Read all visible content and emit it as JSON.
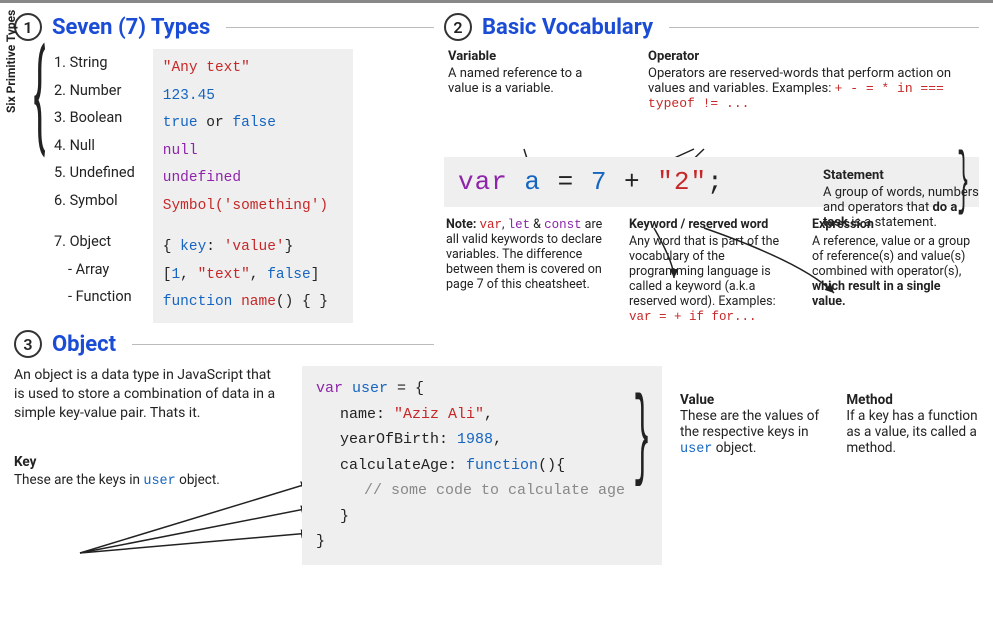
{
  "section1": {
    "num": "1",
    "title": "Seven (7) Types",
    "vertical_label": "Six Primitive Types",
    "labels": [
      "1. String",
      "2. Number",
      "3. Boolean",
      "4. Null",
      "5. Undefined",
      "6. Symbol"
    ],
    "label7": "7. Object",
    "label7a": "- Array",
    "label7b": "- Function",
    "ex_string": "\"Any text\"",
    "ex_number": "123.45",
    "ex_bool_true": "true",
    "ex_bool_or": " or ",
    "ex_bool_false": "false",
    "ex_null": "null",
    "ex_undef": "undefined",
    "ex_symbol_fn": "Symbol",
    "ex_symbol_arg": "('something')",
    "ex_obj_open": "{ ",
    "ex_obj_key": "key",
    "ex_obj_colon": ": ",
    "ex_obj_val": "'value'",
    "ex_obj_close": "}",
    "ex_arr_open": "[",
    "ex_arr_1": "1",
    "ex_arr_c1": ", ",
    "ex_arr_2": "\"text\"",
    "ex_arr_c2": ", ",
    "ex_arr_3": "false",
    "ex_arr_close": "]",
    "ex_fn_kw": "function ",
    "ex_fn_name": "name",
    "ex_fn_paren": "() { }"
  },
  "section2": {
    "num": "2",
    "title": "Basic Vocabulary",
    "variable": {
      "title": "Variable",
      "body": "A named reference to a value is a variable."
    },
    "operator": {
      "title": "Operator",
      "body": "Operators are reserved-words that perform action on values and variables. Examples: ",
      "ex": "+ - = * in === typeof != ..."
    },
    "code": {
      "var": "var ",
      "a": "a",
      "eq": " = ",
      "seven": "7",
      "plus": " + ",
      "two": "\"2\"",
      "semi": ";"
    },
    "brace_right": "}",
    "statement": {
      "title": "Statement",
      "body_a": "A group of words, numbers and operators that ",
      "body_b": "do a task",
      "body_c": " is a statement."
    },
    "note": {
      "label": "Note: ",
      "kw1": "var",
      "c1": ", ",
      "kw2": "let",
      "amp": " & ",
      "kw3": "const",
      "body": " are all valid keywords to declare variables. The difference between them is covered on page 7 of this cheatsheet."
    },
    "keyword": {
      "title": "Keyword / reserved word",
      "body": "Any word that is part of the vocabulary of the programming language is called a keyword (a.k.a reserved word). Examples: ",
      "ex": "var = + if for..."
    },
    "expression": {
      "title": "Expression",
      "body_a": "A reference, value or a group of reference(s) and value(s) combined with operator(s), ",
      "body_b": "which result in a single value."
    }
  },
  "section3": {
    "num": "3",
    "title": "Object",
    "desc": "An object is a data type in JavaScript that is used to store a combination of data in a simple key-value pair. Thats it.",
    "key": {
      "title": "Key",
      "body_a": "These are the keys in ",
      "body_b": "user",
      "body_c": " object."
    },
    "code": {
      "l1_var": "var ",
      "l1_user": "user",
      "l1_eq": " = {",
      "l2_key": "name",
      "l2_c": ": ",
      "l2_val": "\"Aziz Ali\"",
      "l2_end": ",",
      "l3_key": "yearOfBirth",
      "l3_c": ": ",
      "l3_val": "1988",
      "l3_end": ",",
      "l4_key": "calculateAge",
      "l4_c": ": ",
      "l4_fn": "function",
      "l4_paren": "(){",
      "l5": "// some code to calculate age",
      "l6": "}",
      "l7": "}"
    },
    "value": {
      "title": "Value",
      "body_a": "These are the values of the respective keys in ",
      "body_b": "user",
      "body_c": " object."
    },
    "method": {
      "title": "Method",
      "body": "If a key has a function as a value, its called a method."
    }
  }
}
